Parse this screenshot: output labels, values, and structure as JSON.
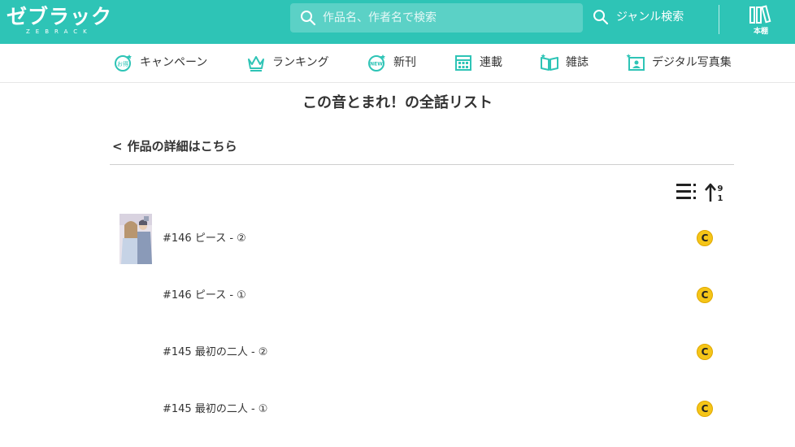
{
  "header": {
    "logo_text": "ゼブラック",
    "logo_sub": "ZEBRACK",
    "search_placeholder": "作品名、作者名で検索",
    "genre_search_label": "ジャンル検索",
    "bookshelf_label": "本棚"
  },
  "nav": {
    "items": [
      {
        "label": "キャンペーン",
        "icon": "campaign-badge-icon",
        "badge": "お得"
      },
      {
        "label": "ランキング",
        "icon": "crown-icon"
      },
      {
        "label": "新刊",
        "icon": "new-badge-icon",
        "badge": "NEW"
      },
      {
        "label": "連載",
        "icon": "calendar-icon"
      },
      {
        "label": "雑誌",
        "icon": "open-book-icon"
      },
      {
        "label": "デジタル写真集",
        "icon": "photo-book-icon"
      }
    ]
  },
  "main": {
    "page_title": "この音とまれ！の全話リスト",
    "back_link_chevron": "<",
    "back_link_label": "作品の詳細はこちら",
    "episodes": [
      {
        "title": "#146 ピース - ②",
        "coin_label": "C"
      },
      {
        "title": "#146 ピース - ①",
        "coin_label": "C"
      },
      {
        "title": "#145 最初の二人 - ②",
        "coin_label": "C"
      },
      {
        "title": "#145 最初の二人 - ①",
        "coin_label": "C"
      }
    ]
  },
  "colors": {
    "brand": "#2ec4b6",
    "coin": "#f5c518",
    "nav_icon": "#2ec4b6"
  }
}
